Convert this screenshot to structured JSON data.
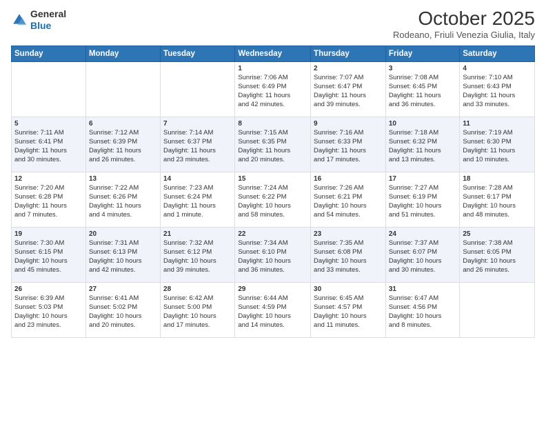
{
  "header": {
    "logo_line1": "General",
    "logo_line2": "Blue",
    "month_year": "October 2025",
    "location": "Rodeano, Friuli Venezia Giulia, Italy"
  },
  "days_of_week": [
    "Sunday",
    "Monday",
    "Tuesday",
    "Wednesday",
    "Thursday",
    "Friday",
    "Saturday"
  ],
  "weeks": [
    [
      {
        "day": "",
        "info": ""
      },
      {
        "day": "",
        "info": ""
      },
      {
        "day": "",
        "info": ""
      },
      {
        "day": "1",
        "info": "Sunrise: 7:06 AM\nSunset: 6:49 PM\nDaylight: 11 hours\nand 42 minutes."
      },
      {
        "day": "2",
        "info": "Sunrise: 7:07 AM\nSunset: 6:47 PM\nDaylight: 11 hours\nand 39 minutes."
      },
      {
        "day": "3",
        "info": "Sunrise: 7:08 AM\nSunset: 6:45 PM\nDaylight: 11 hours\nand 36 minutes."
      },
      {
        "day": "4",
        "info": "Sunrise: 7:10 AM\nSunset: 6:43 PM\nDaylight: 11 hours\nand 33 minutes."
      }
    ],
    [
      {
        "day": "5",
        "info": "Sunrise: 7:11 AM\nSunset: 6:41 PM\nDaylight: 11 hours\nand 30 minutes."
      },
      {
        "day": "6",
        "info": "Sunrise: 7:12 AM\nSunset: 6:39 PM\nDaylight: 11 hours\nand 26 minutes."
      },
      {
        "day": "7",
        "info": "Sunrise: 7:14 AM\nSunset: 6:37 PM\nDaylight: 11 hours\nand 23 minutes."
      },
      {
        "day": "8",
        "info": "Sunrise: 7:15 AM\nSunset: 6:35 PM\nDaylight: 11 hours\nand 20 minutes."
      },
      {
        "day": "9",
        "info": "Sunrise: 7:16 AM\nSunset: 6:33 PM\nDaylight: 11 hours\nand 17 minutes."
      },
      {
        "day": "10",
        "info": "Sunrise: 7:18 AM\nSunset: 6:32 PM\nDaylight: 11 hours\nand 13 minutes."
      },
      {
        "day": "11",
        "info": "Sunrise: 7:19 AM\nSunset: 6:30 PM\nDaylight: 11 hours\nand 10 minutes."
      }
    ],
    [
      {
        "day": "12",
        "info": "Sunrise: 7:20 AM\nSunset: 6:28 PM\nDaylight: 11 hours\nand 7 minutes."
      },
      {
        "day": "13",
        "info": "Sunrise: 7:22 AM\nSunset: 6:26 PM\nDaylight: 11 hours\nand 4 minutes."
      },
      {
        "day": "14",
        "info": "Sunrise: 7:23 AM\nSunset: 6:24 PM\nDaylight: 11 hours\nand 1 minute."
      },
      {
        "day": "15",
        "info": "Sunrise: 7:24 AM\nSunset: 6:22 PM\nDaylight: 10 hours\nand 58 minutes."
      },
      {
        "day": "16",
        "info": "Sunrise: 7:26 AM\nSunset: 6:21 PM\nDaylight: 10 hours\nand 54 minutes."
      },
      {
        "day": "17",
        "info": "Sunrise: 7:27 AM\nSunset: 6:19 PM\nDaylight: 10 hours\nand 51 minutes."
      },
      {
        "day": "18",
        "info": "Sunrise: 7:28 AM\nSunset: 6:17 PM\nDaylight: 10 hours\nand 48 minutes."
      }
    ],
    [
      {
        "day": "19",
        "info": "Sunrise: 7:30 AM\nSunset: 6:15 PM\nDaylight: 10 hours\nand 45 minutes."
      },
      {
        "day": "20",
        "info": "Sunrise: 7:31 AM\nSunset: 6:13 PM\nDaylight: 10 hours\nand 42 minutes."
      },
      {
        "day": "21",
        "info": "Sunrise: 7:32 AM\nSunset: 6:12 PM\nDaylight: 10 hours\nand 39 minutes."
      },
      {
        "day": "22",
        "info": "Sunrise: 7:34 AM\nSunset: 6:10 PM\nDaylight: 10 hours\nand 36 minutes."
      },
      {
        "day": "23",
        "info": "Sunrise: 7:35 AM\nSunset: 6:08 PM\nDaylight: 10 hours\nand 33 minutes."
      },
      {
        "day": "24",
        "info": "Sunrise: 7:37 AM\nSunset: 6:07 PM\nDaylight: 10 hours\nand 30 minutes."
      },
      {
        "day": "25",
        "info": "Sunrise: 7:38 AM\nSunset: 6:05 PM\nDaylight: 10 hours\nand 26 minutes."
      }
    ],
    [
      {
        "day": "26",
        "info": "Sunrise: 6:39 AM\nSunset: 5:03 PM\nDaylight: 10 hours\nand 23 minutes."
      },
      {
        "day": "27",
        "info": "Sunrise: 6:41 AM\nSunset: 5:02 PM\nDaylight: 10 hours\nand 20 minutes."
      },
      {
        "day": "28",
        "info": "Sunrise: 6:42 AM\nSunset: 5:00 PM\nDaylight: 10 hours\nand 17 minutes."
      },
      {
        "day": "29",
        "info": "Sunrise: 6:44 AM\nSunset: 4:59 PM\nDaylight: 10 hours\nand 14 minutes."
      },
      {
        "day": "30",
        "info": "Sunrise: 6:45 AM\nSunset: 4:57 PM\nDaylight: 10 hours\nand 11 minutes."
      },
      {
        "day": "31",
        "info": "Sunrise: 6:47 AM\nSunset: 4:56 PM\nDaylight: 10 hours\nand 8 minutes."
      },
      {
        "day": "",
        "info": ""
      }
    ]
  ]
}
